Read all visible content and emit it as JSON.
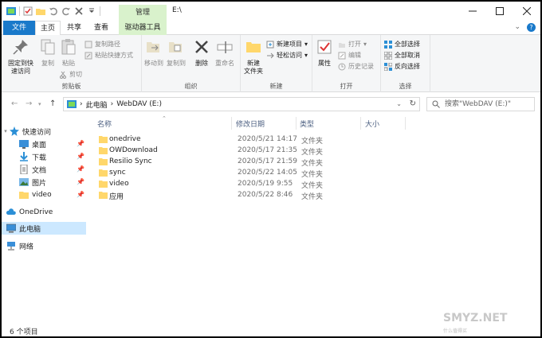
{
  "window": {
    "context_tab": "管理",
    "title": "E:\\",
    "colors": {
      "file_tab": "#1979ca",
      "context_tab": "#d9f2cc",
      "selection": "#cce8ff",
      "folder": "#ffd76b"
    }
  },
  "tabs": {
    "file": "文件",
    "home": "主页",
    "share": "共享",
    "view": "查看",
    "drive_tools": "驱动器工具"
  },
  "ribbon": {
    "clipboard": {
      "label": "剪贴板",
      "pin": "固定到快\n速访问",
      "copy": "复制",
      "paste": "粘贴",
      "copy_path": "复制路径",
      "paste_shortcut": "粘贴快捷方式",
      "cut": "剪切"
    },
    "organize": {
      "label": "组织",
      "move_to": "移动到",
      "copy_to": "复制到",
      "delete": "删除",
      "rename": "重命名"
    },
    "new": {
      "label": "新建",
      "new_folder": "新建\n文件夹",
      "new_item": "新建项目",
      "easy_access": "轻松访问"
    },
    "open": {
      "label": "打开",
      "properties": "属性",
      "open": "打开",
      "edit": "编辑",
      "history": "历史记录"
    },
    "select": {
      "label": "选择",
      "select_all": "全部选择",
      "select_none": "全部取消",
      "invert": "反向选择"
    }
  },
  "address": {
    "crumbs": [
      "此电脑",
      "WebDAV (E:)"
    ],
    "search_placeholder": "搜索\"WebDAV (E:)\""
  },
  "nav": {
    "quick_access": "快速访问",
    "items": [
      {
        "label": "桌面",
        "pinned": true
      },
      {
        "label": "下载",
        "pinned": true
      },
      {
        "label": "文档",
        "pinned": true
      },
      {
        "label": "图片",
        "pinned": true
      },
      {
        "label": "video",
        "pinned": true
      }
    ],
    "onedrive": "OneDrive",
    "this_pc": "此电脑",
    "network": "网络"
  },
  "columns": {
    "name": "名称",
    "date": "修改日期",
    "type": "类型",
    "size": "大小"
  },
  "files": [
    {
      "name": "onedrive",
      "date": "2020/5/21 14:17",
      "type": "文件夹"
    },
    {
      "name": "OWDownload",
      "date": "2020/5/17 21:35",
      "type": "文件夹"
    },
    {
      "name": "Resilio Sync",
      "date": "2020/5/17 21:59",
      "type": "文件夹"
    },
    {
      "name": "sync",
      "date": "2020/5/22 14:05",
      "type": "文件夹"
    },
    {
      "name": "video",
      "date": "2020/5/19 9:55",
      "type": "文件夹"
    },
    {
      "name": "应用",
      "date": "2020/5/22 8:46",
      "type": "文件夹"
    }
  ],
  "status": {
    "count": "6 个项目"
  },
  "watermark": {
    "text": "SMYZ.NET",
    "sub": "什么值得买"
  }
}
